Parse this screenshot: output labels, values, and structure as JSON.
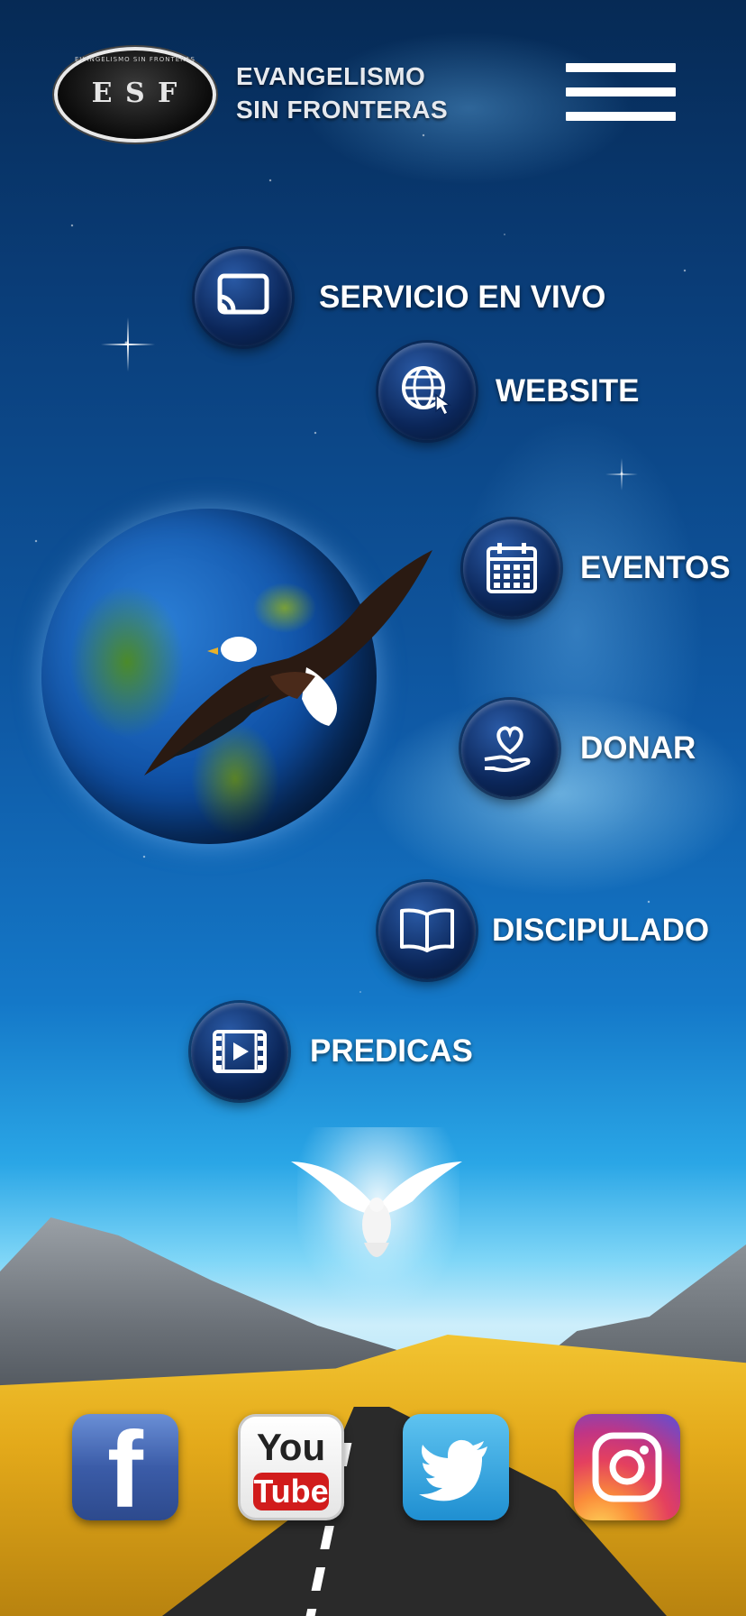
{
  "header": {
    "logo_text": "E S F",
    "logo_ring_text": "EVANGELISMO SIN FRONTERAS",
    "brand_line1": "EVANGELISMO",
    "brand_line2": "SIN FRONTERAS",
    "menu_icon": "hamburger-menu-icon"
  },
  "menu": {
    "items": [
      {
        "label": "SERVICIO EN VIVO",
        "icon": "cast-icon"
      },
      {
        "label": "WEBSITE",
        "icon": "globe-click-icon"
      },
      {
        "label": "EVENTOS",
        "icon": "calendar-icon"
      },
      {
        "label": "DONAR",
        "icon": "heart-hand-icon"
      },
      {
        "label": "DISCIPULADO",
        "icon": "open-book-icon"
      },
      {
        "label": "PREDICAS",
        "icon": "video-film-icon"
      }
    ]
  },
  "social": {
    "facebook": {
      "glyph": "f",
      "icon": "facebook-icon"
    },
    "youtube": {
      "you": "You",
      "tube": "Tube",
      "icon": "youtube-icon"
    },
    "twitter": {
      "icon": "twitter-icon"
    },
    "instagram": {
      "icon": "instagram-icon"
    }
  },
  "colors": {
    "sky_top": "#062a55",
    "sky_mid": "#1478c8",
    "menu_circle": "#0b2659",
    "text": "#ffffff",
    "field": "#e3a91a"
  }
}
